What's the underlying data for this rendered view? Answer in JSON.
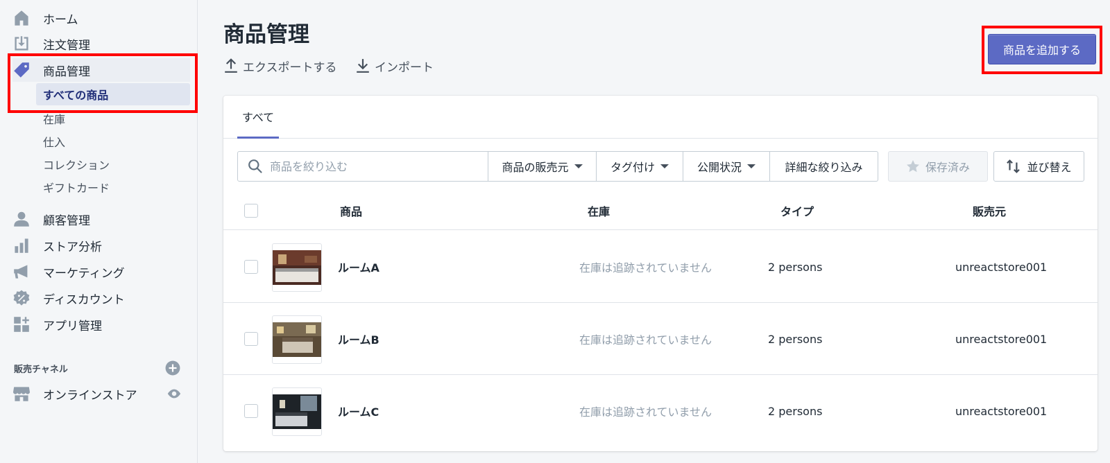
{
  "sidebar": {
    "items": [
      {
        "label": "ホーム",
        "icon": "home-icon"
      },
      {
        "label": "注文管理",
        "icon": "orders-icon"
      },
      {
        "label": "商品管理",
        "icon": "tag-icon"
      },
      {
        "label": "顧客管理",
        "icon": "customer-icon"
      },
      {
        "label": "ストア分析",
        "icon": "analytics-icon"
      },
      {
        "label": "マーケティング",
        "icon": "megaphone-icon"
      },
      {
        "label": "ディスカウント",
        "icon": "discount-icon"
      },
      {
        "label": "アプリ管理",
        "icon": "apps-icon"
      }
    ],
    "sub_items": [
      {
        "label": "すべての商品",
        "selected": true
      },
      {
        "label": "在庫"
      },
      {
        "label": "仕入"
      },
      {
        "label": "コレクション"
      },
      {
        "label": "ギフトカード"
      }
    ],
    "channels_heading": "販売チャネル",
    "channel": {
      "label": "オンラインストア",
      "icon": "store-icon"
    }
  },
  "header": {
    "title": "商品管理",
    "export_label": "エクスポートする",
    "import_label": "インポート",
    "add_button": "商品を追加する"
  },
  "tabs": [
    {
      "label": "すべて"
    }
  ],
  "filters": {
    "search_placeholder": "商品を絞り込む",
    "vendor": "商品の販売元",
    "tagged": "タグ付け",
    "status": "公開状況",
    "more": "詳細な絞り込み",
    "saved": "保存済み",
    "sort": "並び替え"
  },
  "table": {
    "columns": [
      "商品",
      "在庫",
      "タイプ",
      "販売元"
    ],
    "rows": [
      {
        "name": "ルームA",
        "inventory": "在庫は追跡されていません",
        "type": "2 persons",
        "vendor": "unreactstore001"
      },
      {
        "name": "ルームB",
        "inventory": "在庫は追跡されていません",
        "type": "2 persons",
        "vendor": "unreactstore001"
      },
      {
        "name": "ルームC",
        "inventory": "在庫は追跡されていません",
        "type": "2 persons",
        "vendor": "unreactstore001"
      }
    ]
  },
  "colors": {
    "accent": "#5c6ac4",
    "highlight": "#ff0000"
  }
}
